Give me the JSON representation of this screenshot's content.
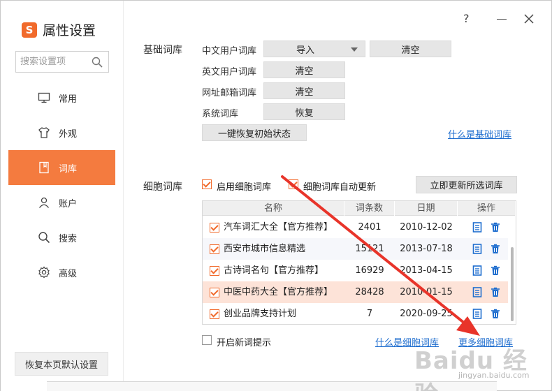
{
  "brand": {
    "logo_char": "S",
    "title": "属性设置"
  },
  "window_controls": {
    "help": "?",
    "close": "×"
  },
  "search": {
    "placeholder": "搜索设置项"
  },
  "nav": [
    {
      "label": "常用",
      "icon": "monitor-icon"
    },
    {
      "label": "外观",
      "icon": "shirt-icon"
    },
    {
      "label": "词库",
      "icon": "book-icon",
      "active": true
    },
    {
      "label": "账户",
      "icon": "user-icon"
    },
    {
      "label": "搜索",
      "icon": "search-icon"
    },
    {
      "label": "高级",
      "icon": "gear-icon"
    }
  ],
  "reset_default": "恢复本页默认设置",
  "basic": {
    "section": "基础词库",
    "chinese_user": {
      "label": "中文用户词库",
      "import": "导入",
      "clear": "清空"
    },
    "english_user": {
      "label": "英文用户词库",
      "clear": "清空"
    },
    "url_email": {
      "label": "网址邮箱词库",
      "clear": "清空"
    },
    "system": {
      "label": "系统词库",
      "restore": "恢复"
    },
    "restore_all": "一键恢复初始状态",
    "what_link": "什么是基础词库"
  },
  "cell": {
    "section": "细胞词库",
    "enable": "启用细胞词库",
    "auto_update": "细胞词库自动更新",
    "update_now": "立即更新所选词库",
    "columns": {
      "name": "名称",
      "count": "词条数",
      "date": "日期",
      "ops": "操作"
    },
    "rows": [
      {
        "name": "汽车词汇大全【官方推荐】",
        "count": "2401",
        "date": "2010-12-02",
        "checked": true
      },
      {
        "name": "西安市城市信息精选",
        "count": "15121",
        "date": "2013-07-18",
        "checked": true
      },
      {
        "name": "古诗词名句【官方推荐】",
        "count": "16929",
        "date": "2013-04-15",
        "checked": true
      },
      {
        "name": "中医中药大全【官方推荐】",
        "count": "28428",
        "date": "2010-01-15",
        "checked": true
      },
      {
        "name": "创业品牌支持计划",
        "count": "7",
        "date": "2020-09-25",
        "checked": true
      }
    ],
    "new_word_hint": "开启新词提示",
    "what_link": "什么是细胞词库",
    "more_link": "更多细胞词库"
  },
  "watermark": {
    "main": "Baidu 经验",
    "sub": "jingyan.baidu.com"
  },
  "colors": {
    "accent": "#f47b3f",
    "link": "#1f6ecf",
    "highlight_row": "#fde3d8",
    "arrow": "#e8342a"
  }
}
